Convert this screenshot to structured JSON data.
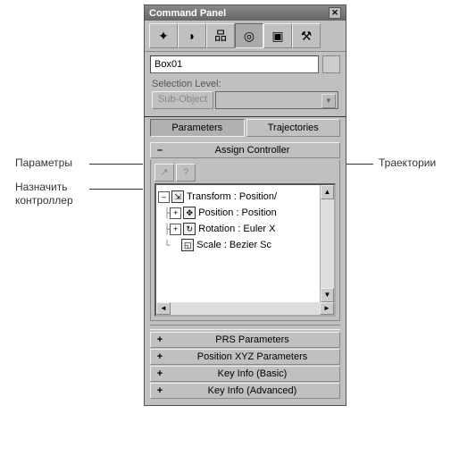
{
  "window": {
    "title": "Command Panel"
  },
  "toolbar_icons": {
    "create": "✦",
    "modify": "◗",
    "hierarchy": "品",
    "motion": "◎",
    "display": "▣",
    "utilities": "⚒"
  },
  "object_name": "Box01",
  "selection_level_label": "Selection Level:",
  "sub_object_label": "Sub-Object",
  "tabs": {
    "parameters": "Parameters",
    "trajectories": "Trajectories"
  },
  "assign_controller": {
    "title": "Assign Controller",
    "help_label": "?",
    "tree": {
      "root": "Transform : Position/",
      "children": [
        "Position : Position",
        "Rotation : Euler X",
        "Scale : Bezier Sc"
      ]
    }
  },
  "rollups": [
    "PRS Parameters",
    "Position XYZ Parameters",
    "Key Info (Basic)",
    "Key Info (Advanced)"
  ],
  "annotations": {
    "left1": "Параметры",
    "left2_a": "Назначить",
    "left2_b": "контроллер",
    "right1": "Траектории"
  }
}
